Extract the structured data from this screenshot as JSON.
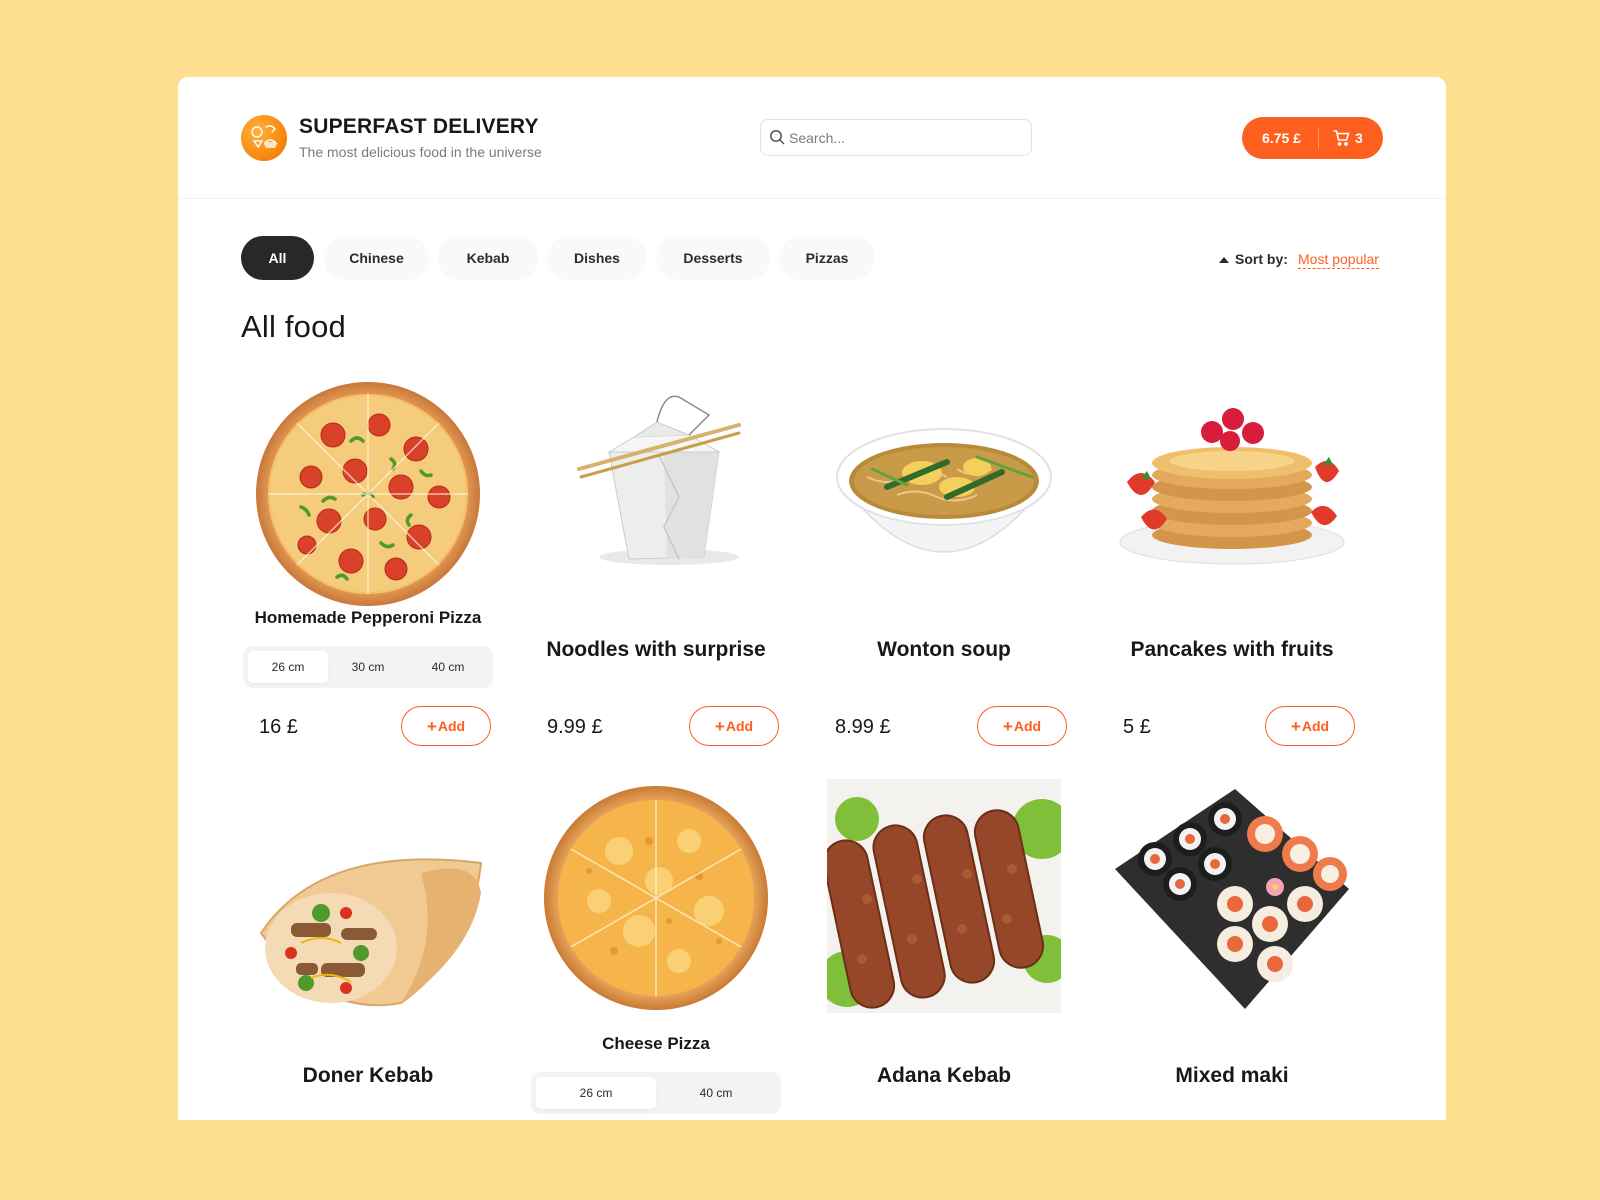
{
  "header": {
    "brand_title": "SUPERFAST DELIVERY",
    "brand_subtitle": "The most delicious food in the universe",
    "search_placeholder": "Search...",
    "cart_total": "6.75 £",
    "cart_count": "3"
  },
  "categories": [
    "All",
    "Chinese",
    "Kebab",
    "Dishes",
    "Desserts",
    "Pizzas"
  ],
  "active_category": "All",
  "sort": {
    "label": "Sort by:",
    "value": "Most popular"
  },
  "section_title": "All food",
  "add_label": "Add",
  "products": [
    {
      "name": "Homemade Pepperoni Pizza",
      "price": "16 £",
      "sizes": [
        "26 cm",
        "30 cm",
        "40 cm"
      ],
      "active_size": "26 cm",
      "image": "pepperoni-pizza"
    },
    {
      "name": "Noodles with surprise",
      "price": "9.99 £",
      "image": "noodle-box"
    },
    {
      "name": "Wonton soup",
      "price": "8.99 £",
      "image": "wonton-soup"
    },
    {
      "name": "Pancakes with fruits",
      "price": "5 £",
      "image": "pancakes"
    },
    {
      "name": "Doner Kebab",
      "image": "doner-kebab"
    },
    {
      "name": "Cheese Pizza",
      "sizes": [
        "26 cm",
        "40 cm"
      ],
      "active_size": "26 cm",
      "image": "cheese-pizza"
    },
    {
      "name": "Adana Kebab",
      "image": "adana-kebab"
    },
    {
      "name": "Mixed maki",
      "image": "sushi"
    }
  ],
  "colors": {
    "page_background": "#fedf90",
    "accent": "#fe5f1e",
    "active_category": "#282828",
    "chip_background": "#f9f9f9"
  }
}
